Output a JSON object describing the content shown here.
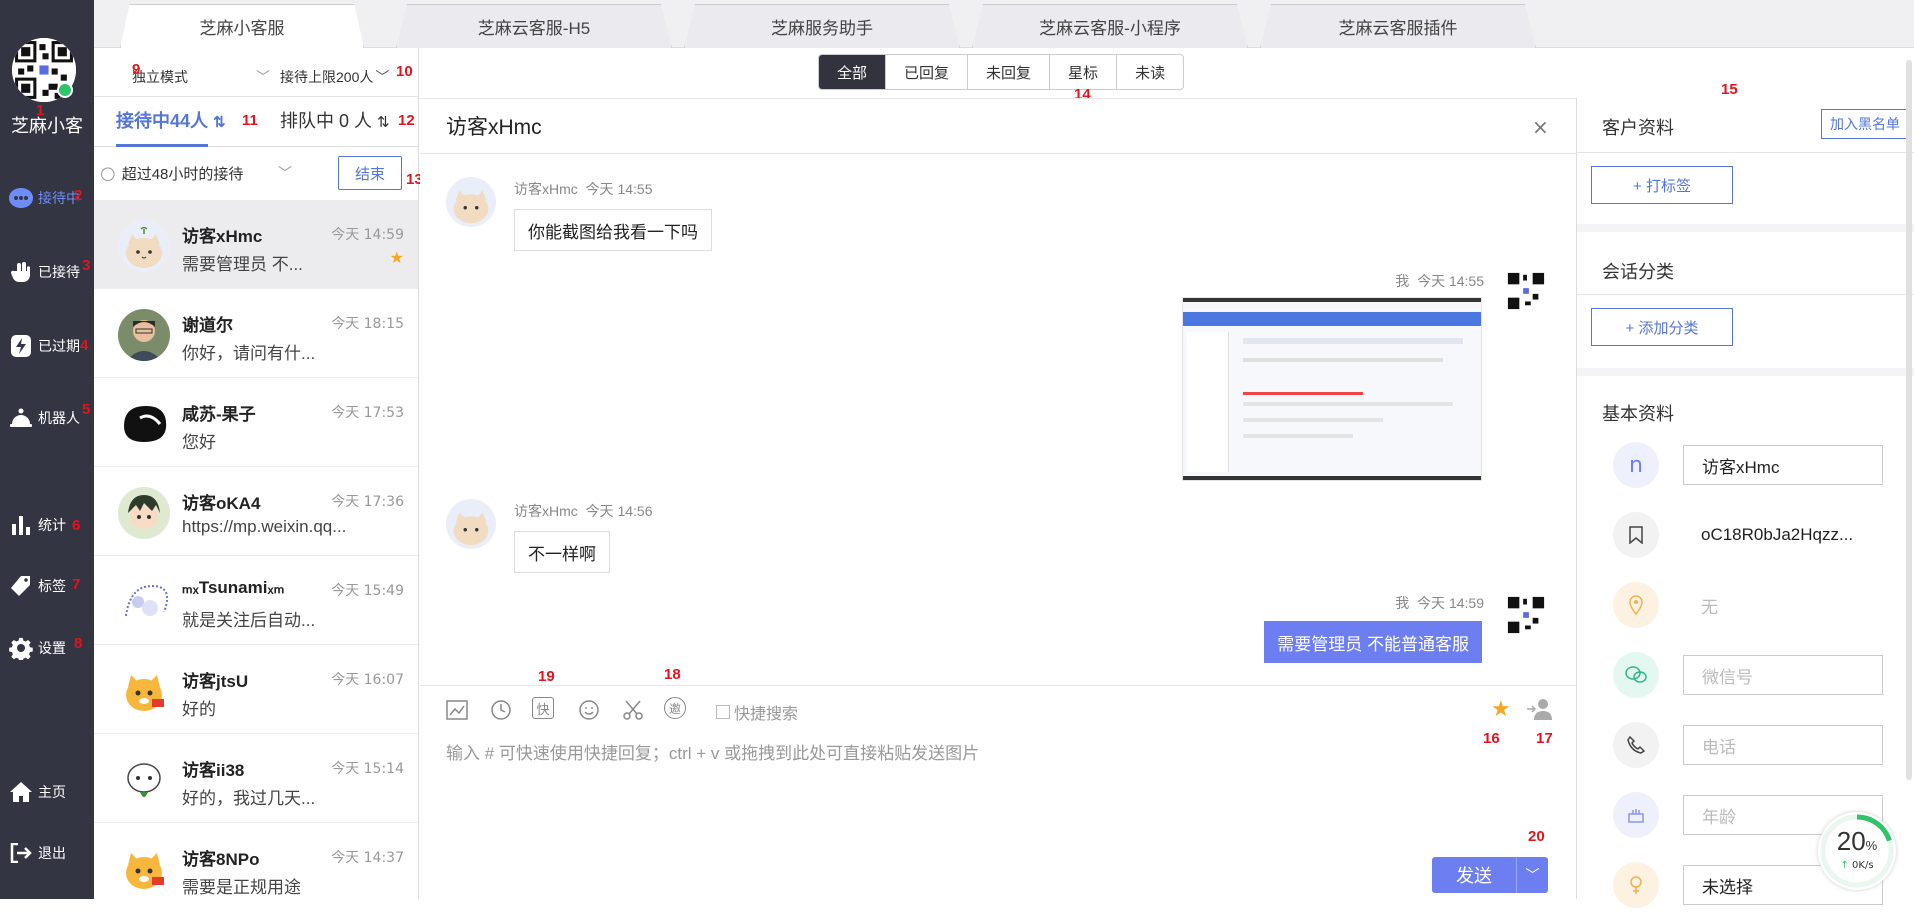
{
  "sidebar": {
    "brand": "芝麻小客",
    "items": [
      {
        "label": "接待中",
        "icon": "chat-bubble-icon"
      },
      {
        "label": "已接待",
        "icon": "hand-icon"
      },
      {
        "label": "已过期",
        "icon": "flash-icon"
      },
      {
        "label": "机器人",
        "icon": "robot-icon"
      },
      {
        "label": "统计",
        "icon": "bar-chart-icon"
      },
      {
        "label": "标签",
        "icon": "tag-icon"
      },
      {
        "label": "设置",
        "icon": "gear-icon"
      },
      {
        "label": "主页",
        "icon": "home-icon"
      },
      {
        "label": "退出",
        "icon": "logout-icon"
      }
    ]
  },
  "tabs": [
    "芝麻小客服",
    "芝麻云客服-H5",
    "芝麻服务助手",
    "芝麻云客服-小程序",
    "芝麻云客服插件"
  ],
  "conversation_panel": {
    "mode_select": "独立模式",
    "limit_select": "接待上限200人",
    "serving_tab": "接待中44人",
    "queue_tab": "排队中 0 人",
    "filter_select": "超过48小时的接待",
    "end_button": "结束"
  },
  "conversations": [
    {
      "name": "访客xHmc",
      "time": "今天 14:59",
      "message": "需要管理员 不...",
      "starred": true
    },
    {
      "name": "谢道尔",
      "time": "今天 18:15",
      "message": "你好，请问有什..."
    },
    {
      "name": "咸苏-果子",
      "time": "今天 17:53",
      "message": "您好"
    },
    {
      "name": "访客oKA4",
      "time": "今天 17:36",
      "message": "https://mp.weixin.qq..."
    },
    {
      "name": "Tsunami",
      "time": "今天 15:49",
      "message": "就是关注后自动..."
    },
    {
      "name": "访客jtsU",
      "time": "今天 16:07",
      "message": "好的"
    },
    {
      "name": "访客ii38",
      "time": "今天 15:14",
      "message": "好的，我过几天..."
    },
    {
      "name": "访客8NPo",
      "time": "今天 14:37",
      "message": "需要是正规用途"
    }
  ],
  "filters": [
    "全部",
    "已回复",
    "未回复",
    "星标",
    "未读"
  ],
  "chat": {
    "title": "访客xHmc",
    "messages": [
      {
        "sender": "访客xHmc",
        "time": "今天 14:55",
        "text": "你能截图给我看一下吗"
      },
      {
        "sender": "我",
        "time": "今天 14:55",
        "text": ""
      },
      {
        "sender": "访客xHmc",
        "time": "今天 14:56",
        "text": "不一样啊"
      },
      {
        "sender": "我",
        "time": "今天 14:59",
        "text": "需要管理员   不能普通客服"
      }
    ],
    "quick_search_label": "快捷搜索",
    "input_placeholder": "输入 # 可快速使用快捷回复；ctrl + v 或拖拽到此处可直接粘贴发送图片",
    "send_button": "发送"
  },
  "customer_panel": {
    "title": "客户资料",
    "blacklist_button": "加入黑名单",
    "add_tag_button": "+ 打标签",
    "session_category_title": "会话分类",
    "add_category_button": "+ 添加分类",
    "basic_info_title": "基本资料",
    "fields": [
      {
        "icon": "name-icon",
        "value": "访客xHmc",
        "boxed": true,
        "placeholder": false
      },
      {
        "icon": "bookmark-icon",
        "value": "oC18R0bJa2Hqzz...",
        "boxed": false,
        "placeholder": false
      },
      {
        "icon": "location-icon",
        "value": "无",
        "boxed": false,
        "placeholder": true
      },
      {
        "icon": "wechat-icon",
        "value": "微信号",
        "boxed": true,
        "placeholder": true
      },
      {
        "icon": "phone-icon",
        "value": "电话",
        "boxed": true,
        "placeholder": true
      },
      {
        "icon": "cake-icon",
        "value": "年龄",
        "boxed": true,
        "placeholder": true
      },
      {
        "icon": "gender-icon",
        "value": "未选择",
        "boxed": true,
        "placeholder": false
      }
    ]
  },
  "network_widget": {
    "percent": "20",
    "percent_unit": "%",
    "speed": "0K/s",
    "progress": 0.2
  },
  "annotations": [
    "1",
    "2",
    "3",
    "4",
    "5",
    "6",
    "7",
    "8",
    "9",
    "10",
    "11",
    "12",
    "13",
    "14",
    "15",
    "16",
    "17",
    "18",
    "19",
    "20"
  ],
  "colors": {
    "sidebar": "#333542",
    "accent": "#5675d8",
    "my_bubble": "#6d7ef0",
    "star": "#f5a623",
    "online": "#2ec46b"
  }
}
